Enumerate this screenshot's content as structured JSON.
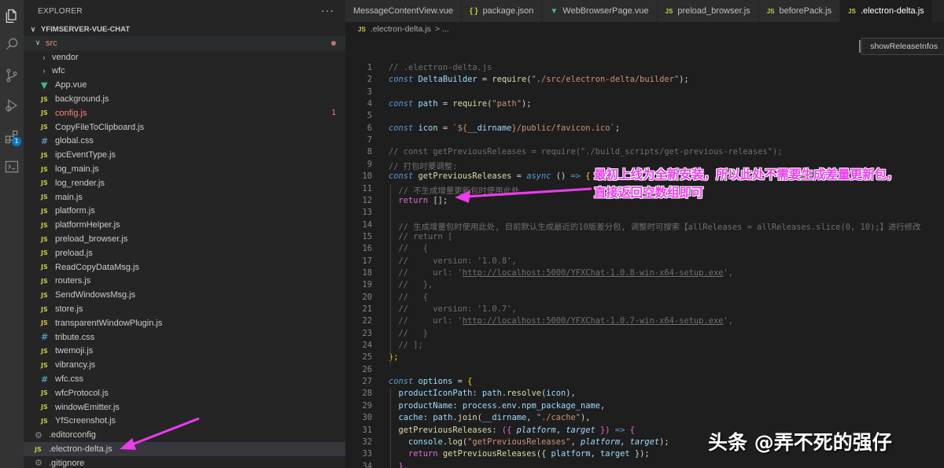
{
  "sidebar": {
    "header": "EXPLORER",
    "more": "···",
    "project": "YFIMSERVER-VUE-CHAT",
    "tree": [
      {
        "label": "src",
        "kind": "folder-open",
        "color": "red",
        "dot": true
      },
      {
        "label": "vendor",
        "kind": "folder"
      },
      {
        "label": "wfc",
        "kind": "folder"
      },
      {
        "label": "App.vue",
        "kind": "vue"
      },
      {
        "label": "background.js",
        "kind": "js"
      },
      {
        "label": "config.js",
        "kind": "js",
        "color": "red",
        "badge": "1"
      },
      {
        "label": "CopyFileToClipboard.js",
        "kind": "js"
      },
      {
        "label": "global.css",
        "kind": "css"
      },
      {
        "label": "ipcEventType.js",
        "kind": "js"
      },
      {
        "label": "log_main.js",
        "kind": "js"
      },
      {
        "label": "log_render.js",
        "kind": "js"
      },
      {
        "label": "main.js",
        "kind": "js"
      },
      {
        "label": "platform.js",
        "kind": "js"
      },
      {
        "label": "platformHelper.js",
        "kind": "js"
      },
      {
        "label": "preload_browser.js",
        "kind": "js"
      },
      {
        "label": "preload.js",
        "kind": "js"
      },
      {
        "label": "ReadCopyDataMsg.js",
        "kind": "js"
      },
      {
        "label": "routers.js",
        "kind": "js"
      },
      {
        "label": "SendWindowsMsg.js",
        "kind": "js"
      },
      {
        "label": "store.js",
        "kind": "js"
      },
      {
        "label": "transparentWindowPlugin.js",
        "kind": "js"
      },
      {
        "label": "tribute.css",
        "kind": "css"
      },
      {
        "label": "twemoji.js",
        "kind": "js"
      },
      {
        "label": "vibrancy.js",
        "kind": "js"
      },
      {
        "label": "wfc.css",
        "kind": "css"
      },
      {
        "label": "wfcProtocol.js",
        "kind": "js"
      },
      {
        "label": "windowEmitter.js",
        "kind": "js"
      },
      {
        "label": "YfScreenshot.js",
        "kind": "js"
      },
      {
        "label": ".editorconfig",
        "kind": "config",
        "root": true
      },
      {
        "label": ".electron-delta.js",
        "kind": "js",
        "root": true,
        "active": true
      },
      {
        "label": ".gitignore",
        "kind": "config",
        "root": true
      }
    ]
  },
  "activity_bar": {
    "icons": [
      "explorer-icon",
      "search-icon",
      "source-control-icon",
      "run-debug-icon",
      "extensions-icon",
      "terminal-icon"
    ],
    "extensions_badge": "1"
  },
  "tabs": [
    {
      "label": "MessageContentView.vue",
      "icon": ""
    },
    {
      "label": "package.json",
      "icon": "{ }"
    },
    {
      "label": "WebBrowserPage.vue",
      "icon": "vue"
    },
    {
      "label": "preload_browser.js",
      "icon": "JS"
    },
    {
      "label": "beforePack.js",
      "icon": "JS"
    },
    {
      "label": ".electron-delta.js",
      "icon": "JS",
      "active": true
    }
  ],
  "breadcrumb": {
    "icon": "JS",
    "file": ".electron-delta.js",
    "rest": "> ..."
  },
  "outline_button": "showReleaseInfos",
  "code_lines": [
    {
      "n": "1",
      "t": [
        [
          "// .electron-delta.js",
          "cm"
        ]
      ]
    },
    {
      "n": "2",
      "t": [
        [
          "const",
          "k"
        ],
        [
          " ",
          "o"
        ],
        [
          "DeltaBuilder",
          "v"
        ],
        [
          " = ",
          "o"
        ],
        [
          "require",
          "f"
        ],
        [
          "(",
          "o"
        ],
        [
          "\"./src/electron-delta/builder\"",
          "s"
        ],
        [
          ");",
          "o"
        ]
      ]
    },
    {
      "n": "3",
      "t": []
    },
    {
      "n": "4",
      "t": [
        [
          "const",
          "k"
        ],
        [
          " ",
          "o"
        ],
        [
          "path",
          "v"
        ],
        [
          " = ",
          "o"
        ],
        [
          "require",
          "f"
        ],
        [
          "(",
          "o"
        ],
        [
          "\"path\"",
          "s"
        ],
        [
          ");",
          "o"
        ]
      ]
    },
    {
      "n": "5",
      "t": []
    },
    {
      "n": "6",
      "t": [
        [
          "const",
          "k"
        ],
        [
          " ",
          "o"
        ],
        [
          "icon",
          "v"
        ],
        [
          " = ",
          "o"
        ],
        [
          "`${",
          "s"
        ],
        [
          "__dirname",
          "v"
        ],
        [
          "}/public/favicon.ico`",
          "s"
        ],
        [
          ";",
          "o"
        ]
      ]
    },
    {
      "n": "7",
      "t": []
    },
    {
      "n": "8",
      "t": [
        [
          "// const getPreviousReleases = require(\"./build_scripts/get-previous-releases\");",
          "cm"
        ]
      ]
    },
    {
      "n": "9",
      "t": [
        [
          "// 打包时要调整:",
          "cm"
        ]
      ]
    },
    {
      "n": "10",
      "t": [
        [
          "const",
          "k"
        ],
        [
          " ",
          "o"
        ],
        [
          "getPreviousReleases",
          "f"
        ],
        [
          " = ",
          "o"
        ],
        [
          "async",
          "k"
        ],
        [
          " () ",
          "o"
        ],
        [
          "=>",
          "k"
        ],
        [
          " {",
          "y"
        ]
      ]
    },
    {
      "n": "11",
      "t": [
        [
          "  // 不生成增量更新包时使用此处",
          "cm"
        ]
      ]
    },
    {
      "n": "12",
      "t": [
        [
          "  ",
          "o"
        ],
        [
          "return",
          "pk"
        ],
        [
          " [];",
          "o"
        ]
      ]
    },
    {
      "n": "13",
      "t": []
    },
    {
      "n": "14",
      "t": [
        [
          "  // 生成增量包时使用此处, 目前默认生成最近的10版差分包, 调整时可搜索【allReleases = allReleases.slice(0, 10);】进行修改",
          "cm"
        ]
      ]
    },
    {
      "n": "15",
      "t": [
        [
          "  // return [",
          "cm"
        ]
      ]
    },
    {
      "n": "16",
      "t": [
        [
          "  //   {",
          "cm"
        ]
      ]
    },
    {
      "n": "17",
      "t": [
        [
          "  //     version: '1.0.8',",
          "cm"
        ]
      ]
    },
    {
      "n": "18",
      "t": [
        [
          "  //     url: '",
          "cm"
        ],
        [
          "http://localhost:5000/YFXChat-1.0.8-win-x64-setup.exe",
          "cmu"
        ],
        [
          "',",
          "cm"
        ]
      ]
    },
    {
      "n": "19",
      "t": [
        [
          "  //   },",
          "cm"
        ]
      ]
    },
    {
      "n": "20",
      "t": [
        [
          "  //   {",
          "cm"
        ]
      ]
    },
    {
      "n": "21",
      "t": [
        [
          "  //     version: '1.0.7',",
          "cm"
        ]
      ]
    },
    {
      "n": "22",
      "t": [
        [
          "  //     url: '",
          "cm"
        ],
        [
          "http://localhost:5000/YFXChat-1.0.7-win-x64-setup.exe",
          "cmu"
        ],
        [
          "',",
          "cm"
        ]
      ]
    },
    {
      "n": "23",
      "t": [
        [
          "  //   }",
          "cm"
        ]
      ]
    },
    {
      "n": "24",
      "t": [
        [
          "  // ];",
          "cm"
        ]
      ]
    },
    {
      "n": "25",
      "t": [
        [
          "};",
          "y"
        ]
      ]
    },
    {
      "n": "26",
      "t": []
    },
    {
      "n": "27",
      "t": [
        [
          "const",
          "k"
        ],
        [
          " ",
          "o"
        ],
        [
          "options",
          "v"
        ],
        [
          " = ",
          "o"
        ],
        [
          "{",
          "y"
        ]
      ]
    },
    {
      "n": "28",
      "t": [
        [
          "  productIconPath",
          "v"
        ],
        [
          ": ",
          "o"
        ],
        [
          "path",
          "v"
        ],
        [
          ".",
          "o"
        ],
        [
          "resolve",
          "f"
        ],
        [
          "(",
          "o"
        ],
        [
          "icon",
          "v"
        ],
        [
          "),",
          "o"
        ]
      ]
    },
    {
      "n": "29",
      "t": [
        [
          "  productName",
          "v"
        ],
        [
          ": ",
          "o"
        ],
        [
          "process",
          "v"
        ],
        [
          ".",
          "o"
        ],
        [
          "env",
          "v"
        ],
        [
          ".",
          "o"
        ],
        [
          "npm_package_name",
          "v"
        ],
        [
          ",",
          "o"
        ]
      ]
    },
    {
      "n": "30",
      "t": [
        [
          "  cache",
          "v"
        ],
        [
          ": ",
          "o"
        ],
        [
          "path",
          "v"
        ],
        [
          ".",
          "o"
        ],
        [
          "join",
          "f"
        ],
        [
          "(",
          "o"
        ],
        [
          "__dirname",
          "v"
        ],
        [
          ", ",
          "o"
        ],
        [
          "\"./cache\"",
          "s"
        ],
        [
          "),",
          "o"
        ]
      ]
    },
    {
      "n": "31",
      "t": [
        [
          "  getPreviousReleases",
          "f"
        ],
        [
          ": ",
          "o"
        ],
        [
          "({ ",
          "pk"
        ],
        [
          "platform",
          "p"
        ],
        [
          ", ",
          "o"
        ],
        [
          "target",
          "p"
        ],
        [
          " })",
          "pk"
        ],
        [
          " => ",
          "k"
        ],
        [
          "{",
          "pk"
        ]
      ]
    },
    {
      "n": "32",
      "t": [
        [
          "    console",
          "v"
        ],
        [
          ".",
          "o"
        ],
        [
          "log",
          "f"
        ],
        [
          "(",
          "o"
        ],
        [
          "\"getPreviousReleases\"",
          "s"
        ],
        [
          ", ",
          "o"
        ],
        [
          "platform",
          "p"
        ],
        [
          ", ",
          "o"
        ],
        [
          "target",
          "p"
        ],
        [
          ");",
          "o"
        ]
      ]
    },
    {
      "n": "33",
      "t": [
        [
          "    ",
          "o"
        ],
        [
          "return",
          "pk"
        ],
        [
          " ",
          "o"
        ],
        [
          "getPreviousReleases",
          "f"
        ],
        [
          "({ ",
          "o"
        ],
        [
          "platform",
          "v"
        ],
        [
          ", ",
          "o"
        ],
        [
          "target",
          "v"
        ],
        [
          " });",
          "o"
        ]
      ]
    },
    {
      "n": "34",
      "t": [
        [
          "  },",
          "pk"
        ]
      ]
    }
  ],
  "annotation": {
    "line1": "最初上线为全新安装，所以此处不需要生成差量更新包，",
    "line2": "直接返回空数组即可"
  },
  "watermark": "头条 @弄不死的强仔",
  "colors": {
    "annotation": "#ee3bee",
    "accent": "#007acc"
  }
}
